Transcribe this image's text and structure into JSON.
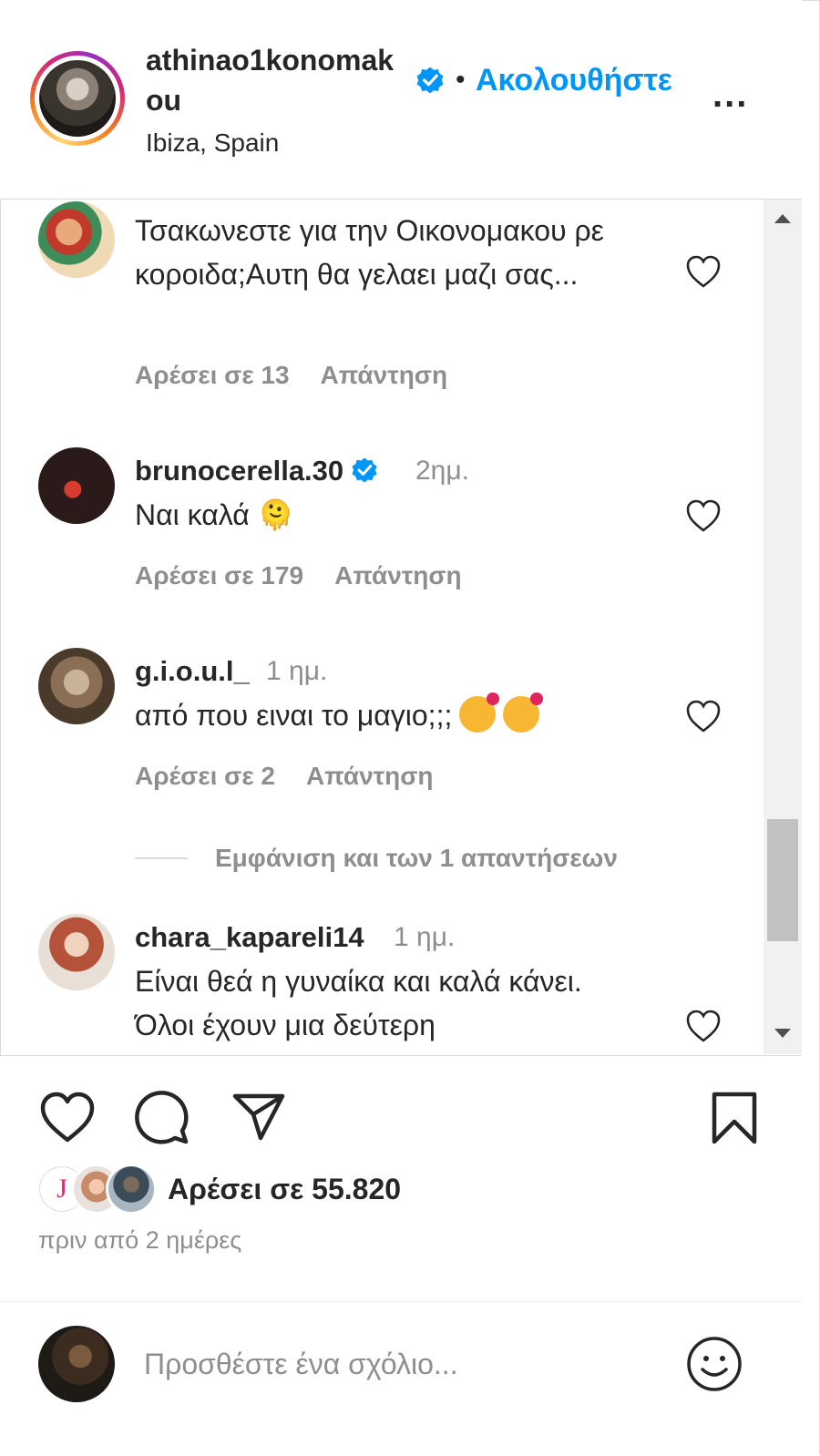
{
  "header": {
    "username": "athinao1konomakou",
    "location": "Ibiza, Spain",
    "follow_label": "Ακολουθήστε",
    "separator": "•",
    "more_label": "..."
  },
  "comments": [
    {
      "text": "Τσακωνεστε για την Οικονομακου ρε κοροιδα;Αυτη θα γελαει μαζι σας...",
      "likes": "Αρέσει σε 13",
      "reply_label": "Απάντηση"
    },
    {
      "user": "brunocerella.30",
      "verified": true,
      "time": "2ημ.",
      "text": "Ναι καλά 🫠",
      "likes": "Αρέσει σε 179",
      "reply_label": "Απάντηση"
    },
    {
      "user": "g.i.o.u.l_",
      "time": "1 ημ.",
      "text": "από που ειναι το μαγιο;;;",
      "likes": "Αρέσει σε 2",
      "reply_label": "Απάντηση",
      "view_replies": "Εμφάνιση και των 1 απαντήσεων"
    },
    {
      "user": "chara_kapareli14",
      "time": "1 ημ.",
      "text": "Είναι θεά η γυναίκα και καλά κάνει. Όλοι έχουν μια δεύτερη"
    }
  ],
  "actions": {
    "likes_text": "Αρέσει σε 55.820",
    "date": "πριν από 2 ημέρες",
    "liker_initial": "J"
  },
  "add_comment": {
    "placeholder": "Προσθέστε ένα σχόλιο..."
  },
  "colors": {
    "link_blue": "#0095f6",
    "text": "#262626",
    "muted": "#8e8e8e",
    "border": "#dbdbdb"
  }
}
